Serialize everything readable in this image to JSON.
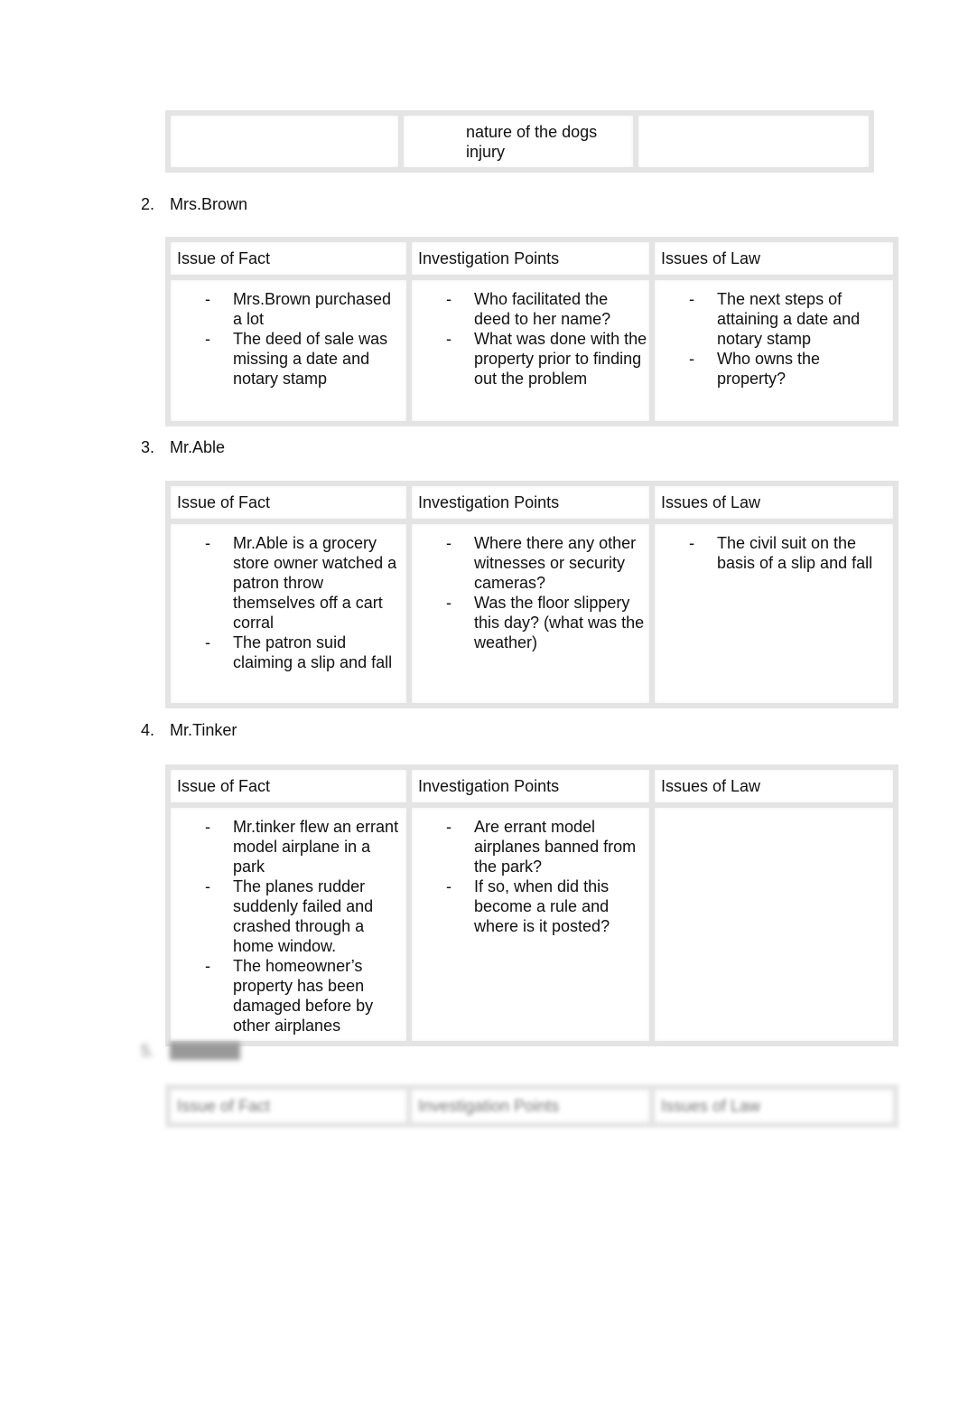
{
  "headers": [
    "Issue of Fact",
    "Investigation Points",
    "Issues of Law"
  ],
  "table1": {
    "cols": [
      [],
      [
        {
          "text": "nature of the dogs injury",
          "nodash": true
        }
      ],
      []
    ]
  },
  "sections": [
    {
      "id": "2",
      "number": "2.",
      "name": "Mrs.Brown",
      "cols": [
        [
          "Mrs.Brown purchased a lot",
          "The deed of sale was missing a date and notary stamp"
        ],
        [
          "Who facilitated the deed to her name?",
          "What was done with the property prior to finding out the problem"
        ],
        [
          "The next steps of attaining a date and notary stamp",
          "Who owns the property?"
        ]
      ]
    },
    {
      "id": "3",
      "number": "3.",
      "name": "Mr.Able",
      "cols": [
        [
          "Mr.Able is a grocery store owner watched a patron throw themselves off a cart corral",
          "The patron suid claiming a slip and fall"
        ],
        [
          "Where there any other witnesses or security cameras?",
          "Was the floor slippery this day? (what was the weather)"
        ],
        [
          "The civil suit on the basis of a slip and fall"
        ]
      ]
    },
    {
      "id": "4",
      "number": "4.",
      "name": "Mr.Tinker",
      "cols": [
        [
          "Mr.tinker flew an errant model airplane in a park",
          "The planes rudder suddenly failed and crashed through a home window.",
          "The homeowner’s property has been damaged before by other airplanes"
        ],
        [
          "Are errant model airplanes banned from the park?",
          "If so, when did this become a rule and where is it posted?"
        ],
        []
      ]
    }
  ],
  "blurred_section": {
    "number": "5.",
    "note": "blurred"
  }
}
